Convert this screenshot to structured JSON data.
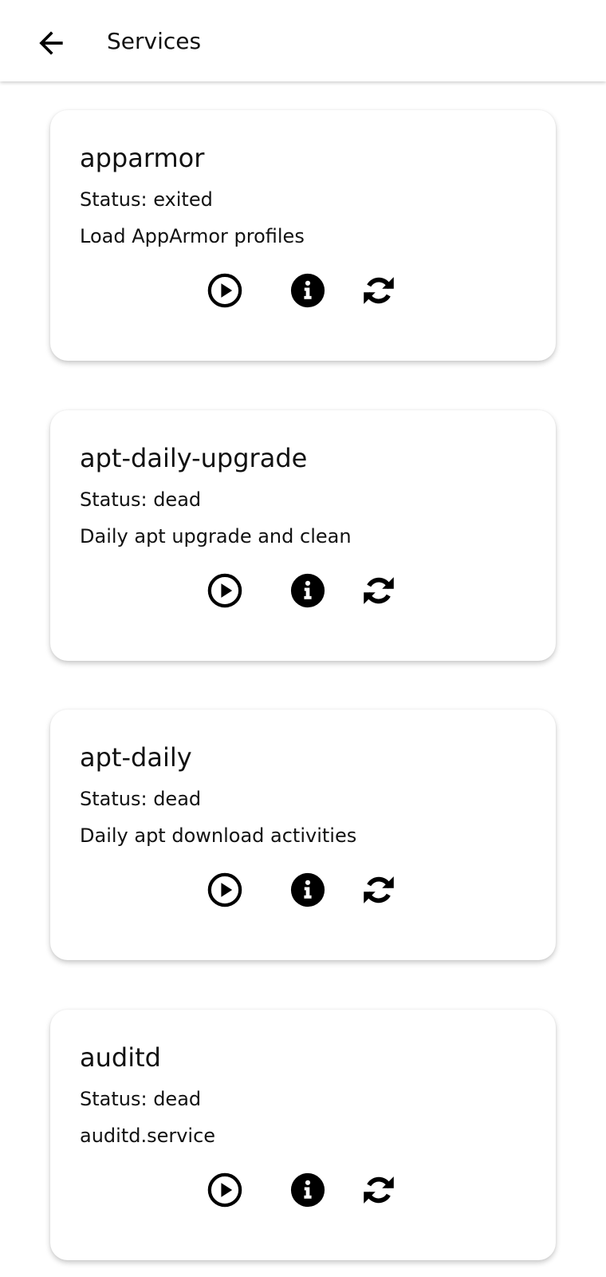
{
  "app_bar": {
    "title": "Services",
    "back_icon": "arrow-left-icon"
  },
  "services": [
    {
      "name": "apparmor",
      "status": "Status: exited",
      "description": "Load AppArmor profiles"
    },
    {
      "name": "apt-daily-upgrade",
      "status": "Status: dead",
      "description": "Daily apt upgrade and clean"
    },
    {
      "name": "apt-daily",
      "status": "Status: dead",
      "description": "Daily apt download activities"
    },
    {
      "name": "auditd",
      "status": "Status: dead",
      "description": "auditd.service"
    }
  ],
  "actions": {
    "start_icon": "play-circle-icon",
    "info_icon": "info-circle-icon",
    "restart_icon": "sync-icon"
  },
  "colors": {
    "background": "#ffffff",
    "text": "#111111",
    "icon": "#000000"
  }
}
